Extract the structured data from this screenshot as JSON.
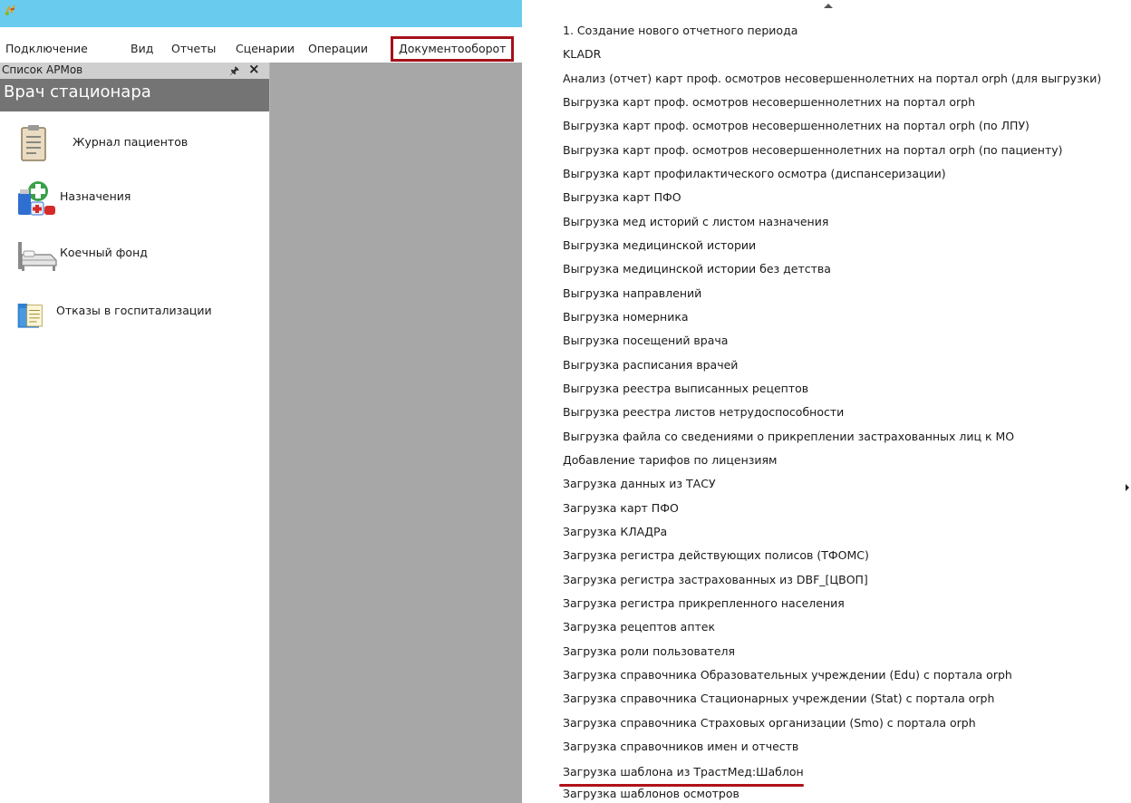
{
  "window": {
    "logo_icon": "app-logo-icon",
    "titlebar_color": "#69ccef"
  },
  "menubar": {
    "items": [
      "Подключение",
      "Вид",
      "Отчеты",
      "Сценарии",
      "Операции",
      "Документооборот"
    ],
    "highlighted_item": "Документооборот",
    "highlight_color": "#a4111a"
  },
  "arm_panel": {
    "title": "Список АРМов",
    "pin_icon": "pin-icon",
    "close_icon": "close-icon",
    "role": "Врач стационара",
    "items": [
      {
        "label": "Журнал пациентов",
        "icon": "clipboard-icon"
      },
      {
        "label": "Назначения",
        "icon": "medicine-icon"
      },
      {
        "label": "Коечный фонд",
        "icon": "hospital-bed-icon"
      },
      {
        "label": "Отказы в госпитализации",
        "icon": "folder-document-icon"
      }
    ]
  },
  "dropdown": {
    "scroll_up_icon": "scroll-up-arrow-icon",
    "submenu_icon": "submenu-arrow-icon",
    "items": [
      "1. Создание нового отчетного периода",
      "KLADR",
      "Анализ (отчет) карт проф. осмотров несовершеннолетних на портал orph (для выгрузки)",
      "Выгрузка карт проф. осмотров несовершеннолетних на портал orph",
      "Выгрузка карт проф. осмотров несовершеннолетних на портал orph (по ЛПУ)",
      "Выгрузка карт проф. осмотров несовершеннолетних на портал orph (по пациенту)",
      "Выгрузка карт профилактического осмотра (диспансеризации)",
      "Выгрузка карт ПФО",
      "Выгрузка мед историй с листом назначения",
      "Выгрузка медицинской истории",
      "Выгрузка медицинской истории без детства",
      "Выгрузка направлений",
      "Выгрузка номерника",
      "Выгрузка посещений врача",
      "Выгрузка расписания врачей",
      "Выгрузка реестра выписанных рецептов",
      "Выгрузка реестра листов нетрудоспособности",
      "Выгрузка файла со сведениями о прикреплении застрахованных лиц к МО",
      "Добавление тарифов по лицензиям",
      "Загрузка данных из ТАСУ",
      "Загрузка карт ПФО",
      "Загрузка КЛАДРа",
      "Загрузка регистра действующих полисов (ТФОМС)",
      "Загрузка регистра застрахованных из DBF_[ЦВОП]",
      "Загрузка регистра прикрепленного населения",
      "Загрузка рецептов аптек",
      "Загрузка роли пользователя",
      "Загрузка справочника Образовательных учреждении (Edu) с портала orph",
      "Загрузка справочника Стационарных учреждении (Stat) с портала orph",
      "Загрузка справочника Страховых организации (Smo) с портала orph",
      "Загрузка справочников имен и отчеств",
      "Загрузка шаблона из ТрастМед:Шаблон",
      "Загрузка шаблонов осмотров"
    ],
    "submenu_item": "Загрузка данных из ТАСУ",
    "underlined_item": "Загрузка шаблона из ТрастМед:Шаблон"
  }
}
